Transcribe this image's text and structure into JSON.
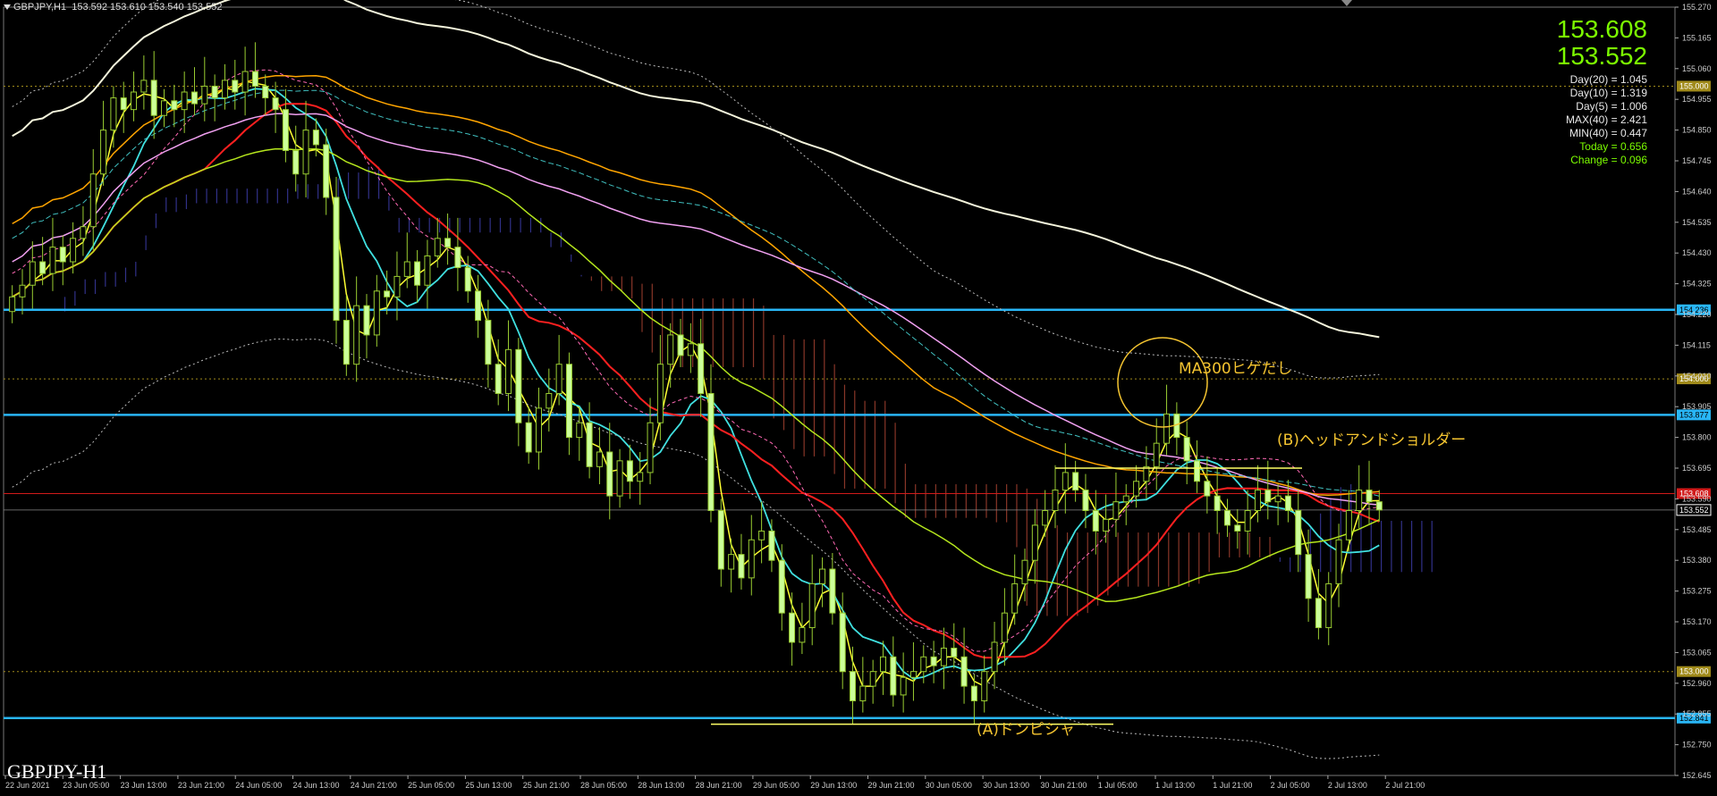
{
  "header": {
    "symbol": "GBPJPY,H1",
    "ohlc": "153.592 153.610 153.540 153.552"
  },
  "quote": {
    "ask": "153.608",
    "bid": "153.552"
  },
  "stats": [
    {
      "label": "Day(20) = 1.045",
      "color": "#e8e8e8"
    },
    {
      "label": "Day(10) = 1.319",
      "color": "#e8e8e8"
    },
    {
      "label": "Day(5) = 1.006",
      "color": "#e8e8e8"
    },
    {
      "label": "MAX(40) = 2.421",
      "color": "#e8e8e8"
    },
    {
      "label": "MIN(40) = 0.447",
      "color": "#e8e8e8"
    },
    {
      "label": "Today = 0.656",
      "color": "#7CFC00"
    },
    {
      "label": "Change = 0.096",
      "color": "#7CFC00"
    }
  ],
  "watermark": "GBPJPY-H1",
  "annotations": {
    "ma300": "MA300ヒゲだし",
    "head_shoulder": "(B)ヘッドアンドショルダー",
    "donpisha": "(A)ドンピシャ"
  },
  "chart_data": {
    "type": "candlestick",
    "y_ticks": [
      "155.270",
      "155.165",
      "155.060",
      "154.955",
      "154.850",
      "154.745",
      "154.640",
      "154.535",
      "154.430",
      "154.325",
      "154.220",
      "154.115",
      "154.010",
      "153.905",
      "153.800",
      "153.695",
      "153.590",
      "153.485",
      "153.380",
      "153.275",
      "153.170",
      "153.065",
      "152.960",
      "152.855",
      "152.750",
      "152.645"
    ],
    "ylim": [
      152.645,
      155.27
    ],
    "x_ticks": [
      "22 Jun 2021",
      "23 Jun 05:00",
      "23 Jun 13:00",
      "23 Jun 21:00",
      "24 Jun 05:00",
      "24 Jun 13:00",
      "24 Jun 21:00",
      "25 Jun 05:00",
      "25 Jun 13:00",
      "25 Jun 21:00",
      "28 Jun 05:00",
      "28 Jun 13:00",
      "28 Jun 21:00",
      "29 Jun 05:00",
      "29 Jun 13:00",
      "29 Jun 21:00",
      "30 Jun 05:00",
      "30 Jun 13:00",
      "30 Jun 21:00",
      "1 Jul 05:00",
      "1 Jul 13:00",
      "1 Jul 21:00",
      "2 Jul 05:00",
      "2 Jul 13:00",
      "2 Jul 21:00"
    ],
    "horizontal_levels": [
      {
        "value": 154.236,
        "label": "154.236",
        "color": "#29b6f6"
      },
      {
        "value": 153.877,
        "label": "153.877",
        "color": "#29b6f6"
      },
      {
        "value": 152.841,
        "label": "152.841",
        "color": "#29b6f6"
      },
      {
        "value": 153.608,
        "label": "153.608",
        "color": "#d11a1a"
      },
      {
        "value": 155.0,
        "label": "155.000",
        "color": "#a08a1a"
      },
      {
        "value": 154.0,
        "label": "154.000",
        "color": "#a08a1a"
      },
      {
        "value": 153.0,
        "label": "153.000",
        "color": "#a08a1a"
      }
    ],
    "current_price": {
      "value": 153.552,
      "label": "153.552"
    },
    "closes": [
      154.28,
      154.32,
      154.4,
      154.36,
      154.45,
      154.4,
      154.48,
      154.52,
      154.7,
      154.85,
      154.96,
      154.92,
      154.98,
      155.02,
      154.9,
      154.95,
      154.92,
      154.98,
      154.94,
      155.0,
      154.96,
      155.02,
      154.98,
      155.05,
      155.0,
      154.96,
      154.92,
      154.78,
      154.7,
      154.85,
      154.8,
      154.62,
      154.2,
      154.05,
      154.25,
      154.15,
      154.3,
      154.28,
      154.35,
      154.4,
      154.32,
      154.42,
      154.48,
      154.45,
      154.38,
      154.3,
      154.2,
      154.05,
      153.95,
      154.1,
      153.85,
      153.75,
      153.9,
      153.95,
      154.05,
      153.8,
      153.85,
      153.7,
      153.75,
      153.6,
      153.72,
      153.65,
      153.68,
      153.85,
      154.05,
      154.15,
      154.08,
      154.12,
      153.95,
      153.55,
      153.35,
      153.4,
      153.32,
      153.45,
      153.48,
      153.38,
      153.2,
      153.1,
      153.15,
      153.3,
      153.35,
      153.2,
      153.0,
      152.9,
      152.95,
      153.0,
      153.05,
      152.92,
      152.98,
      153.0,
      153.05,
      153.02,
      153.08,
      153.05,
      152.95,
      152.9,
      153.0,
      153.1,
      153.2,
      153.3,
      153.38,
      153.5,
      153.55,
      153.62,
      153.68,
      153.62,
      153.55,
      153.48,
      153.52,
      153.58,
      153.6,
      153.65,
      153.7,
      153.78,
      153.88,
      153.8,
      153.72,
      153.65,
      153.6,
      153.55,
      153.5,
      153.48,
      153.55,
      153.62,
      153.58,
      153.6,
      153.55,
      153.4,
      153.25,
      153.15,
      153.3,
      153.45,
      153.55,
      153.62,
      153.58,
      153.552
    ]
  }
}
